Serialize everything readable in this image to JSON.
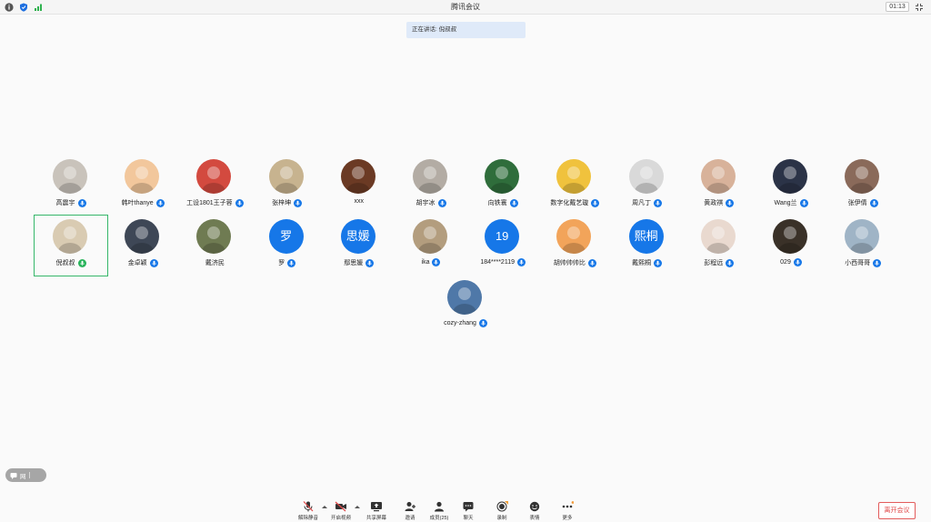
{
  "window": {
    "title": "腾讯会议",
    "timer": "01:13"
  },
  "speaking": {
    "label": "正在讲话: 倪叔叔"
  },
  "participants": [
    {
      "name": "高震宇",
      "color": "#c9c3bb",
      "mic": "blue"
    },
    {
      "name": "韩叶thanye",
      "color": "#f2c79c",
      "mic": "blue"
    },
    {
      "name": "工设1801王子蓉",
      "color": "#d34a3f",
      "mic": "blue"
    },
    {
      "name": "张梓坤",
      "color": "#c7b38f",
      "mic": "blue"
    },
    {
      "name": "xxx",
      "color": "#6b3a24",
      "mic": "none"
    },
    {
      "name": "胡宇冰",
      "color": "#b3aca4",
      "mic": "blue"
    },
    {
      "name": "向铁寰",
      "color": "#2f6d3b",
      "mic": "blue"
    },
    {
      "name": "数字化戴艺璇",
      "color": "#f0c23d",
      "mic": "blue"
    },
    {
      "name": "周凡丁",
      "color": "#d9d9d9",
      "mic": "blue"
    },
    {
      "name": "黄政祺",
      "color": "#d8b29a",
      "mic": "blue"
    },
    {
      "name": "Wang兰",
      "color": "#2b3347",
      "mic": "blue"
    },
    {
      "name": "张伊倩",
      "color": "#8a6a5a",
      "mic": "blue"
    },
    {
      "name": "倪叔叔",
      "color": "#d9cbb2",
      "mic": "green",
      "selected": true
    },
    {
      "name": "金卓颖",
      "color": "#3e4756",
      "mic": "blue"
    },
    {
      "name": "戴济民",
      "color": "#6f7b52",
      "mic": "none"
    },
    {
      "name": "罗",
      "initials": "罗",
      "mic": "blue"
    },
    {
      "name": "鄢思媛",
      "initials": "思媛",
      "mic": "blue"
    },
    {
      "name": "ika",
      "color": "#b39d7e",
      "mic": "blue"
    },
    {
      "name": "184****2119",
      "initials": "19",
      "mic": "blue"
    },
    {
      "name": "胡帅帅帅比",
      "color": "#f2a45a",
      "mic": "blue"
    },
    {
      "name": "戴熙桐",
      "initials": "熙桐",
      "mic": "blue"
    },
    {
      "name": "彭程远",
      "color": "#e9d9cf",
      "mic": "blue"
    },
    {
      "name": "029",
      "color": "#3a3128",
      "mic": "blue"
    },
    {
      "name": "小西哥哥",
      "color": "#9fb4c6",
      "mic": "blue"
    },
    {
      "name": "cozy-zhang",
      "color": "#4f78a8",
      "mic": "blue"
    }
  ],
  "chat_pill": {
    "label": "网"
  },
  "toolbar": {
    "mute": "解除静音",
    "video": "开启视频",
    "share": "共享屏幕",
    "invite": "邀请",
    "members": "成员(25)",
    "chat": "聊天",
    "record": "录制",
    "emoji": "表情",
    "more": "更多",
    "leave": "离开会议"
  }
}
